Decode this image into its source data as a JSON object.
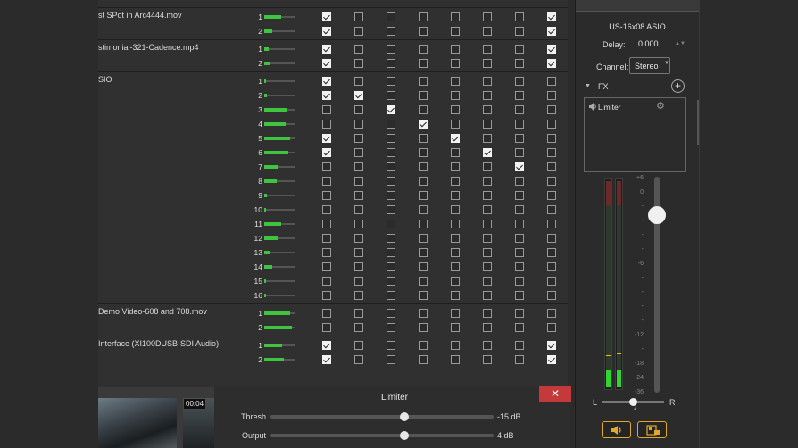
{
  "routing": {
    "groups": [
      {
        "name": "st SPot in Arc4444.mov",
        "channels": [
          {
            "num": "1",
            "level": 0.55,
            "checks": [
              1,
              0,
              0,
              0,
              0,
              0,
              0,
              1
            ]
          },
          {
            "num": "2",
            "level": 0.25,
            "checks": [
              1,
              0,
              0,
              0,
              0,
              0,
              0,
              1
            ]
          }
        ]
      },
      {
        "name": "stimonial-321-Cadence.mp4",
        "channels": [
          {
            "num": "1",
            "level": 0.15,
            "checks": [
              1,
              0,
              0,
              0,
              0,
              0,
              0,
              1
            ]
          },
          {
            "num": "2",
            "level": 0.2,
            "checks": [
              1,
              0,
              0,
              0,
              0,
              0,
              0,
              1
            ]
          }
        ]
      },
      {
        "name": "SIO",
        "channels": [
          {
            "num": "1",
            "level": 0.05,
            "checks": [
              1,
              0,
              0,
              0,
              0,
              0,
              0,
              0
            ]
          },
          {
            "num": "2",
            "level": 0.1,
            "checks": [
              1,
              1,
              0,
              0,
              0,
              0,
              0,
              0
            ]
          },
          {
            "num": "3",
            "level": 0.75,
            "checks": [
              0,
              0,
              1,
              0,
              0,
              0,
              0,
              0
            ]
          },
          {
            "num": "4",
            "level": 0.7,
            "checks": [
              0,
              0,
              0,
              1,
              0,
              0,
              0,
              0
            ]
          },
          {
            "num": "5",
            "level": 0.85,
            "checks": [
              1,
              0,
              0,
              0,
              1,
              0,
              0,
              0
            ]
          },
          {
            "num": "6",
            "level": 0.8,
            "checks": [
              1,
              0,
              0,
              0,
              0,
              1,
              0,
              0
            ]
          },
          {
            "num": "7",
            "level": 0.45,
            "checks": [
              0,
              0,
              0,
              0,
              0,
              0,
              1,
              0
            ]
          },
          {
            "num": "8",
            "level": 0.4,
            "checks": [
              0,
              0,
              0,
              0,
              0,
              0,
              0,
              0
            ]
          },
          {
            "num": "9",
            "level": 0.1,
            "checks": [
              0,
              0,
              0,
              0,
              0,
              0,
              0,
              0
            ]
          },
          {
            "num": "10",
            "level": 0.05,
            "checks": [
              0,
              0,
              0,
              0,
              0,
              0,
              0,
              0
            ]
          },
          {
            "num": "11",
            "level": 0.55,
            "checks": [
              0,
              0,
              0,
              0,
              0,
              0,
              0,
              0
            ]
          },
          {
            "num": "12",
            "level": 0.45,
            "checks": [
              0,
              0,
              0,
              0,
              0,
              0,
              0,
              0
            ]
          },
          {
            "num": "13",
            "level": 0.2,
            "checks": [
              0,
              0,
              0,
              0,
              0,
              0,
              0,
              0
            ]
          },
          {
            "num": "14",
            "level": 0.25,
            "checks": [
              0,
              0,
              0,
              0,
              0,
              0,
              0,
              0
            ]
          },
          {
            "num": "15",
            "level": 0.05,
            "checks": [
              0,
              0,
              0,
              0,
              0,
              0,
              0,
              0
            ]
          },
          {
            "num": "16",
            "level": 0.05,
            "checks": [
              0,
              0,
              0,
              0,
              0,
              0,
              0,
              0
            ]
          }
        ]
      },
      {
        "name": "Demo Video-608 and 708.mov",
        "channels": [
          {
            "num": "1",
            "level": 0.85,
            "checks": [
              0,
              0,
              0,
              0,
              0,
              0,
              0,
              0
            ]
          },
          {
            "num": "2",
            "level": 0.9,
            "checks": [
              0,
              0,
              0,
              0,
              0,
              0,
              0,
              0
            ]
          }
        ]
      },
      {
        "name": "Interface (XI100DUSB-SDI Audio)",
        "channels": [
          {
            "num": "1",
            "level": 0.6,
            "checks": [
              1,
              0,
              0,
              0,
              0,
              0,
              0,
              1
            ]
          },
          {
            "num": "2",
            "level": 0.65,
            "checks": [
              1,
              0,
              0,
              0,
              0,
              0,
              0,
              1
            ]
          }
        ]
      }
    ]
  },
  "preview": {
    "timecode": "00:04"
  },
  "limiter": {
    "title": "Limiter",
    "close": "✕",
    "thresh": {
      "label": "Thresh",
      "value": "-15 dB",
      "position": 0.6
    },
    "output": {
      "label": "Output",
      "value": "4 dB",
      "position": 0.6
    }
  },
  "panel": {
    "device": "US-16x08 ASIO",
    "delay_label": "Delay:",
    "delay_value": "0.000",
    "channel_label": "Channel:",
    "channel_value": "Stereo",
    "fx_label": "FX",
    "fx_items": [
      {
        "name": "Limiter"
      }
    ],
    "meter_scale": [
      "+6",
      "0",
      "-",
      "-",
      "-",
      "-",
      "-6",
      "-",
      "-",
      "-",
      "-",
      "-12",
      "-",
      "-18",
      "-24",
      "-36"
    ],
    "meter_left": {
      "level": 0.08,
      "peak": 0.15
    },
    "meter_right": {
      "level": 0.08,
      "peak": 0.16
    },
    "fader_level": 0.85,
    "pan_left": "L",
    "pan_right": "R",
    "pan_position": 0.5
  }
}
